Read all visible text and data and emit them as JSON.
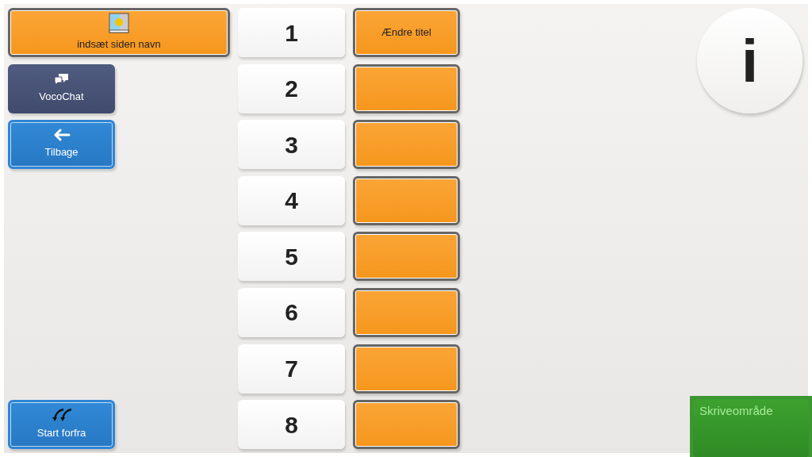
{
  "left_buttons": [
    {
      "label": "indsæt siden navn",
      "kind": "title"
    },
    {
      "label": "VocoChat",
      "kind": "dark"
    },
    {
      "label": "Tilbage",
      "kind": "blue"
    },
    {
      "label": "Start forfra",
      "kind": "blue"
    }
  ],
  "number_keys": [
    "1",
    "2",
    "3",
    "4",
    "5",
    "6",
    "7",
    "8"
  ],
  "slot_buttons": [
    {
      "kind": "labeled",
      "label": "Ændre titel"
    },
    {
      "kind": "blank"
    },
    {
      "kind": "blank"
    },
    {
      "kind": "blank"
    },
    {
      "kind": "blank"
    },
    {
      "kind": "blank"
    },
    {
      "kind": "blank"
    },
    {
      "kind": "blank"
    }
  ],
  "info_button": {
    "label": "i"
  },
  "writing_area": {
    "label": "Skriveområde"
  }
}
